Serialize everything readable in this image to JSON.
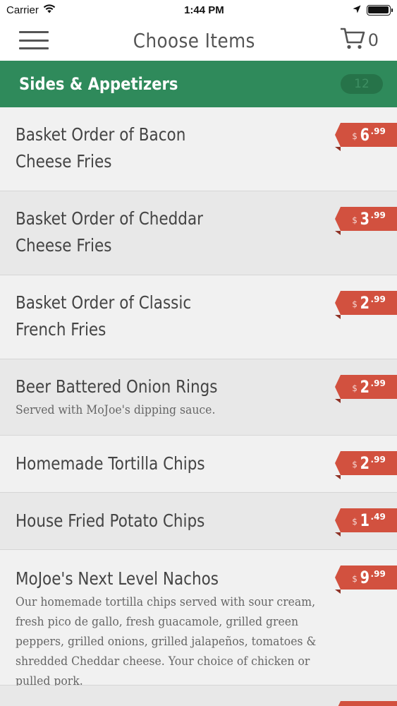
{
  "status": {
    "carrier": "Carrier",
    "time": "1:44 PM"
  },
  "nav": {
    "title": "Choose Items",
    "cart_count": "0"
  },
  "section": {
    "title": "Sides & Appetizers",
    "count": "12"
  },
  "items": [
    {
      "name_l1": "Basket Order of Bacon",
      "name_l2": "Cheese Fries",
      "desc": "",
      "dollar": "$",
      "price_main": "6",
      "price_cents": ".99"
    },
    {
      "name_l1": "Basket Order of Cheddar",
      "name_l2": "Cheese Fries",
      "desc": "",
      "dollar": "$",
      "price_main": "3",
      "price_cents": ".99"
    },
    {
      "name_l1": "Basket Order of Classic",
      "name_l2": "French Fries",
      "desc": "",
      "dollar": "$",
      "price_main": "2",
      "price_cents": ".99"
    },
    {
      "name_l1": "Beer Battered Onion Rings",
      "name_l2": "",
      "desc": "Served with MoJoe's dipping sauce.",
      "dollar": "$",
      "price_main": "2",
      "price_cents": ".99"
    },
    {
      "name_l1": "Homemade Tortilla Chips",
      "name_l2": "",
      "desc": "",
      "dollar": "$",
      "price_main": "2",
      "price_cents": ".99"
    },
    {
      "name_l1": "House Fried Potato Chips",
      "name_l2": "",
      "desc": "",
      "dollar": "$",
      "price_main": "1",
      "price_cents": ".49"
    },
    {
      "name_l1": "MoJoe's Next Level Nachos",
      "name_l2": "",
      "desc": "Our homemade tortilla chips served with sour cream, fresh pico de gallo, fresh guacamole, grilled green peppers, grilled onions, grilled jalapeños, tomatoes & shredded Cheddar cheese. Your choice of chicken or pulled pork.",
      "dollar": "$",
      "price_main": "9",
      "price_cents": ".99"
    }
  ],
  "colors": {
    "header_green": "#2f8a5b",
    "price_red": "#d2513f"
  },
  "icons": {
    "menu": "hamburger-menu-icon",
    "cart": "shopping-cart-icon",
    "wifi": "wifi-icon",
    "location": "location-arrow-icon",
    "battery": "battery-icon"
  }
}
